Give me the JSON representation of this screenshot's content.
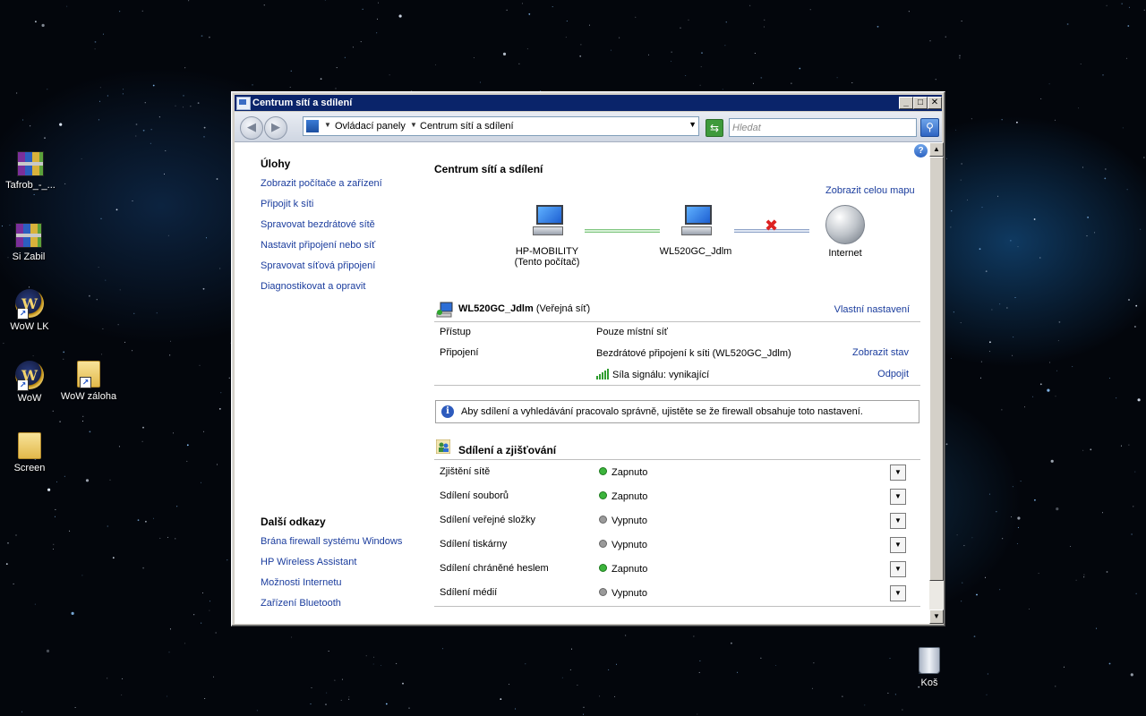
{
  "window": {
    "title": "Centrum sítí a sdílení",
    "controls": {
      "minimize": "_",
      "maximize": "□",
      "close": "✕"
    }
  },
  "navbar": {
    "back_glyph": "◀",
    "forward_glyph": "▶",
    "breadcrumb": [
      "Ovládací panely",
      "Centrum sítí a sdílení"
    ],
    "search_placeholder": "Hledat",
    "search_glyph": "⚲",
    "refresh_glyph": "⇆",
    "dropdown_glyph": "▼"
  },
  "sidebar": {
    "tasks_heading": "Úlohy",
    "tasks": [
      "Zobrazit počítače a zařízení",
      "Připojit k síti",
      "Spravovat bezdrátové sítě",
      "Nastavit připojení nebo síť",
      "Spravovat síťová připojení",
      "Diagnostikovat a opravit"
    ],
    "links_heading": "Další odkazy",
    "links": [
      "Brána firewall systému Windows",
      "HP Wireless Assistant",
      "Možnosti Internetu",
      "Zařízení Bluetooth"
    ]
  },
  "main": {
    "title": "Centrum sítí a sdílení",
    "help_glyph": "?",
    "full_map_link": "Zobrazit celou mapu",
    "map": {
      "computer_name": "HP-MOBILITY",
      "computer_sub": "(Tento počítač)",
      "network_name": "WL520GC_Jdlm",
      "internet_label": "Internet",
      "broken_link_glyph": "✖"
    },
    "network": {
      "name": "WL520GC_Jdlm",
      "type": "(Veřejná síť)",
      "customize_link": "Vlastní nastavení",
      "access_label": "Přístup",
      "access_value": "Pouze místní síť",
      "connection_label": "Připojení",
      "connection_value": "Bezdrátové připojení k síti (WL520GC_Jdlm)",
      "view_status_link": "Zobrazit stav",
      "signal_text": "Síla signálu: vynikající",
      "disconnect_link": "Odpojit"
    },
    "info_glyph": "i",
    "info_text": "Aby sdílení a vyhledávání pracovalo správně, ujistěte se že firewall obsahuje toto nastavení.",
    "sharing_heading": "Sdílení a zjišťování",
    "sharing": [
      {
        "label": "Zjištění sítě",
        "status": "Zapnuto",
        "on": true
      },
      {
        "label": "Sdílení souborů",
        "status": "Zapnuto",
        "on": true
      },
      {
        "label": "Sdílení veřejné složky",
        "status": "Vypnuto",
        "on": false
      },
      {
        "label": "Sdílení tiskárny",
        "status": "Vypnuto",
        "on": false
      },
      {
        "label": "Sdílení chráněné heslem",
        "status": "Zapnuto",
        "on": true
      },
      {
        "label": "Sdílení médií",
        "status": "Vypnuto",
        "on": false
      }
    ],
    "expand_glyph": "▼"
  },
  "scrollbar": {
    "up_glyph": "▲",
    "down_glyph": "▼"
  },
  "desktop": {
    "icons": [
      "Tafrob_-_...",
      "Si Zabil",
      "WoW LK",
      "WoW",
      "WoW záloha",
      "Screen",
      "Koš"
    ]
  },
  "colors": {
    "titlebar": "#0a246a",
    "link": "#1a3c9d",
    "status_on": "#3cb43c",
    "status_off": "#9a9a9a"
  }
}
